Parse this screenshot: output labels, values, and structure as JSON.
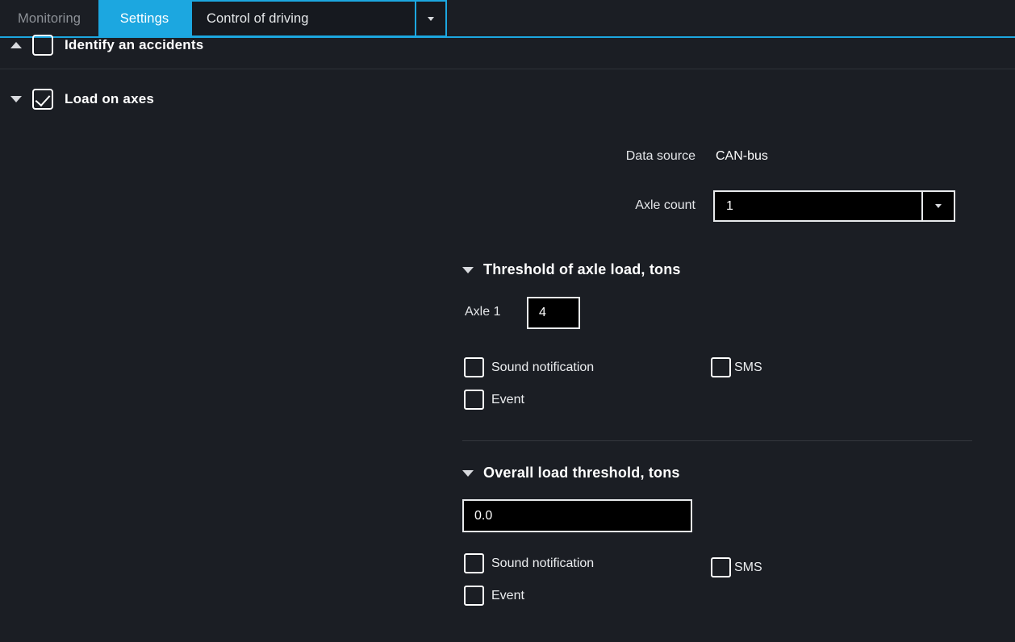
{
  "tabs": {
    "monitoring": "Monitoring",
    "settings": "Settings",
    "control": "Control of driving",
    "control_arrow_icon": "chevron-down-icon"
  },
  "groups": {
    "accidents": {
      "label": "Identify an accidents",
      "checked": false,
      "expanded": true,
      "toggle_icon": "caret-up-icon"
    },
    "load_on_axes": {
      "label": "Load on axes",
      "checked": true,
      "expanded": true,
      "toggle_icon": "caret-down-icon"
    }
  },
  "load_on_axes": {
    "data_source_label": "Data source",
    "data_source_value": "CAN-bus",
    "axle_count_label": "Axle count",
    "axle_count_value": "1",
    "axle_count_arrow_icon": "chevron-down-icon",
    "axle_threshold": {
      "title": "Threshold of axle load, tons",
      "caret_icon": "caret-down-icon",
      "axles": [
        {
          "label": "Axle 1",
          "value": "4"
        }
      ],
      "checks": [
        {
          "label": "Sound notification",
          "checked": false
        },
        {
          "label": "SMS",
          "checked": false
        },
        {
          "label": "Event",
          "checked": false
        }
      ]
    },
    "overall_threshold": {
      "title": "Overall load threshold, tons",
      "caret_icon": "caret-down-icon",
      "value": "0.0",
      "checks": [
        {
          "label": "Sound notification",
          "checked": false
        },
        {
          "label": "SMS",
          "checked": false
        },
        {
          "label": "Event",
          "checked": false
        }
      ]
    }
  },
  "colors": {
    "accent": "#1ca7e0",
    "background": "#1b1e24",
    "input_bg": "#000000",
    "text": "#ffffff",
    "muted_text": "#8d9197"
  }
}
